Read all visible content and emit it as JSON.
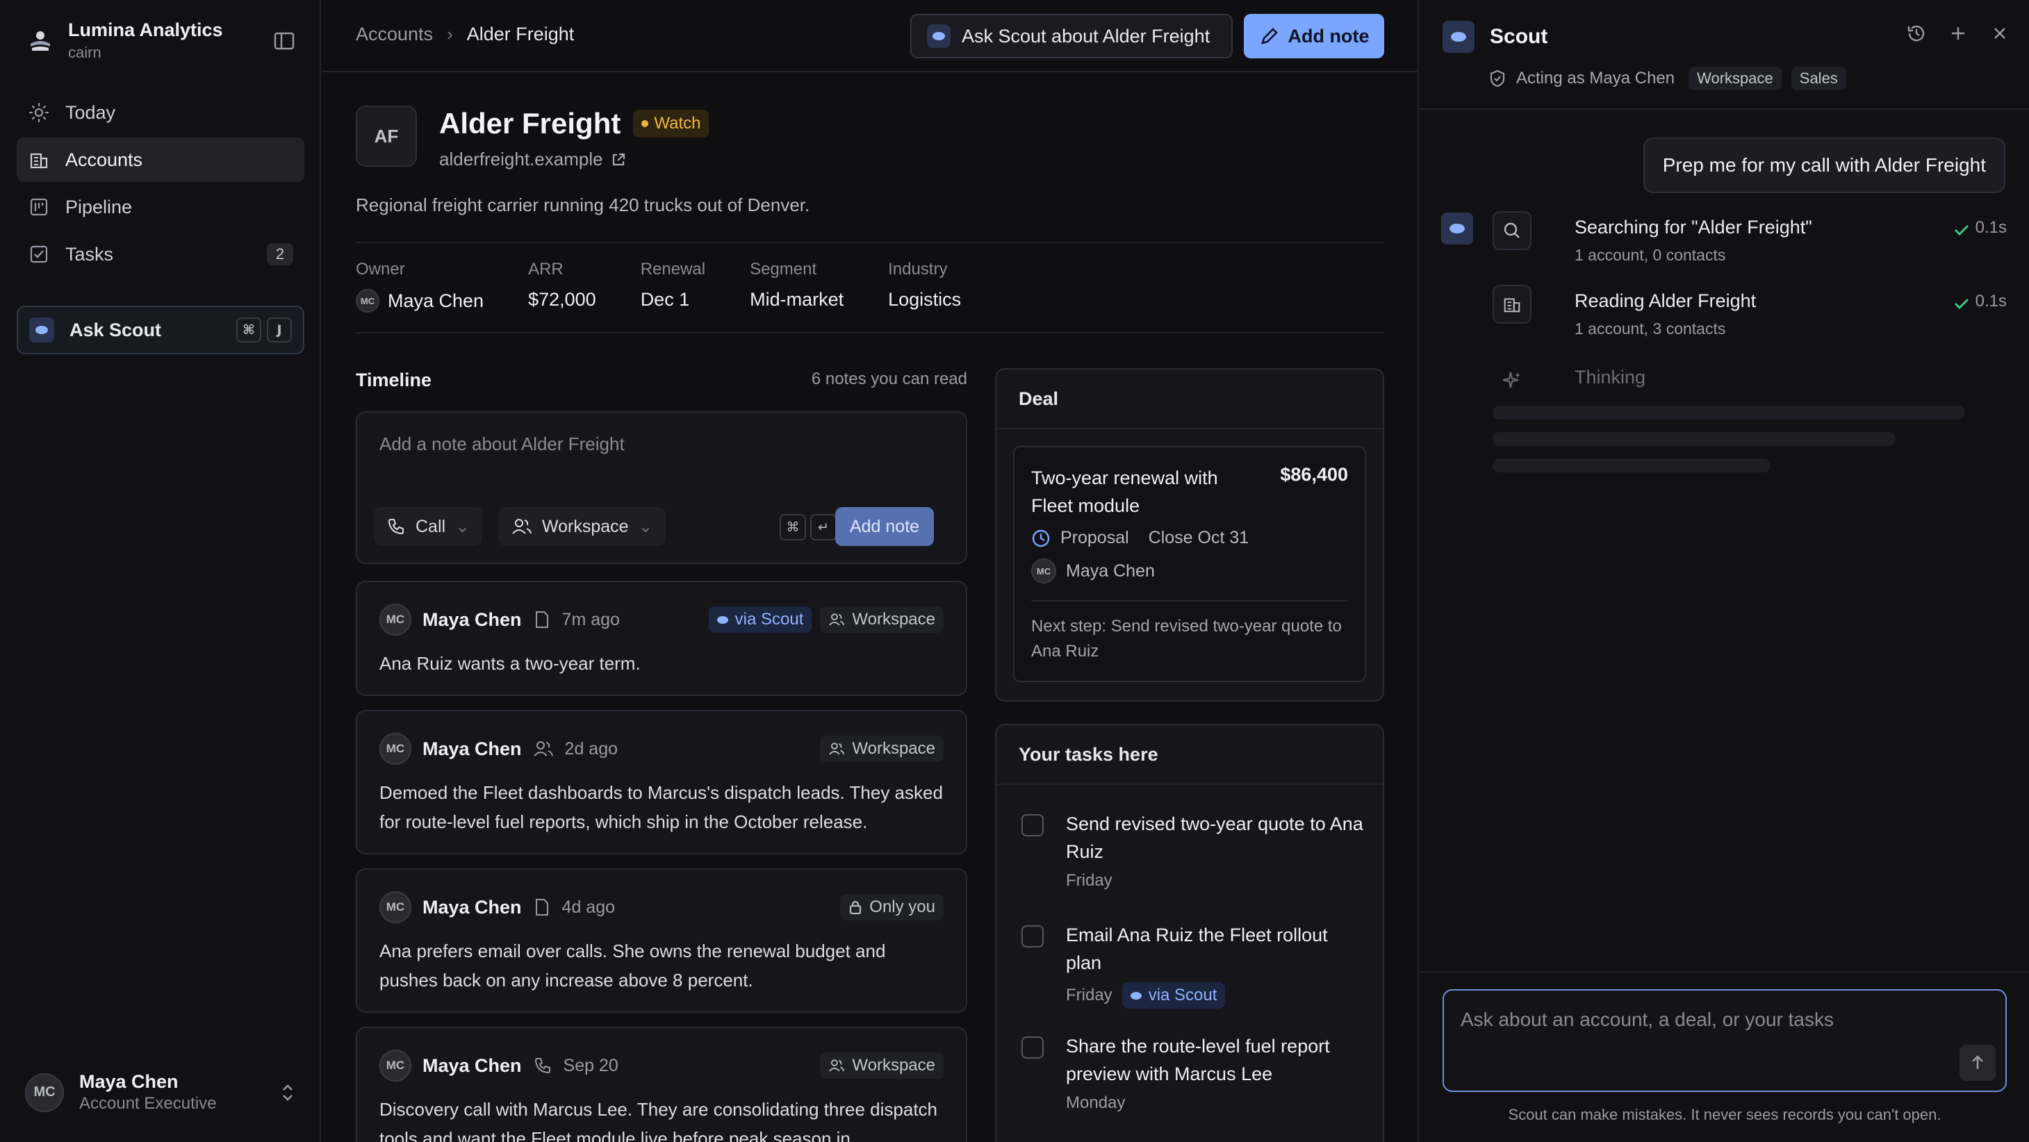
{
  "brand": {
    "name": "Lumina Analytics",
    "workspace": "cairn"
  },
  "sidebar": {
    "items": [
      {
        "label": "Today",
        "icon": "sun-icon"
      },
      {
        "label": "Accounts",
        "icon": "building-icon",
        "active": true
      },
      {
        "label": "Pipeline",
        "icon": "pipeline-icon"
      },
      {
        "label": "Tasks",
        "icon": "checkbox-icon",
        "badge": "2"
      }
    ],
    "ask_scout": {
      "label": "Ask Scout",
      "keys": [
        "⌘",
        "J"
      ]
    },
    "user": {
      "initials": "MC",
      "name": "Maya Chen",
      "role": "Account Executive"
    }
  },
  "header": {
    "breadcrumb": [
      "Accounts",
      "Alder Freight"
    ],
    "ask_button": "Ask Scout about Alder Freight",
    "add_note_button": "Add note"
  },
  "account": {
    "initials": "AF",
    "name": "Alder Freight",
    "status": "Watch",
    "domain": "alderfreight.example",
    "description": "Regional freight carrier running 420 trucks out of Denver.",
    "meta": [
      {
        "label": "Owner",
        "value": "Maya Chen",
        "avatar": "MC"
      },
      {
        "label": "ARR",
        "value": "$72,000"
      },
      {
        "label": "Renewal",
        "value": "Dec 1"
      },
      {
        "label": "Segment",
        "value": "Mid-market"
      },
      {
        "label": "Industry",
        "value": "Logistics"
      }
    ]
  },
  "timeline": {
    "title": "Timeline",
    "count_label": "6 notes you can read",
    "composer": {
      "placeholder": "Add a note about Alder Freight",
      "type": "Call",
      "visibility": "Workspace",
      "keys": [
        "⌘",
        "↵"
      ],
      "submit": "Add note"
    },
    "notes": [
      {
        "initials": "MC",
        "author": "Maya Chen",
        "kind": "note-icon",
        "time": "7m ago",
        "via": "via Scout",
        "visibility": "Workspace",
        "body": "Ana Ruiz wants a two-year term."
      },
      {
        "initials": "MC",
        "author": "Maya Chen",
        "kind": "people-icon",
        "time": "2d ago",
        "visibility": "Workspace",
        "body": "Demoed the Fleet dashboards to Marcus's dispatch leads. They asked for route-level fuel reports, which ship in the October release."
      },
      {
        "initials": "MC",
        "author": "Maya Chen",
        "kind": "note-icon",
        "time": "4d ago",
        "visibility": "Only you",
        "body": "Ana prefers email over calls. She owns the renewal budget and pushes back on any increase above 8 percent."
      },
      {
        "initials": "MC",
        "author": "Maya Chen",
        "kind": "phone-icon",
        "time": "Sep 20",
        "visibility": "Workspace",
        "body": "Discovery call with Marcus Lee. They are consolidating three dispatch tools and want the Fleet module live before peak season in"
      }
    ]
  },
  "deal": {
    "title": "Deal",
    "name": "Two-year renewal with Fleet module",
    "amount": "$86,400",
    "stage": "Proposal",
    "close": "Close Oct 31",
    "owner_initials": "MC",
    "owner": "Maya Chen",
    "next_step": "Next step: Send revised two-year quote to Ana Ruiz"
  },
  "tasks": {
    "title": "Your tasks here",
    "items": [
      {
        "title": "Send revised two-year quote to Ana Ruiz",
        "due": "Friday"
      },
      {
        "title": "Email Ana Ruiz the Fleet rollout plan",
        "due": "Friday",
        "via": "via Scout"
      },
      {
        "title": "Share the route-level fuel report preview with Marcus Lee",
        "due": "Monday"
      }
    ]
  },
  "scout": {
    "title": "Scout",
    "acting_as": "Acting as Maya Chen",
    "scopes": [
      "Workspace",
      "Sales"
    ],
    "user_message": "Prep me for my call with Alder Freight",
    "steps": [
      {
        "title": "Searching for \"Alder Freight\"",
        "sub": "1 account, 0 contacts",
        "time": "0.1s",
        "icon": "search-icon"
      },
      {
        "title": "Reading Alder Freight",
        "sub": "1 account, 3 contacts",
        "time": "0.1s",
        "icon": "building-icon"
      },
      {
        "title": "Thinking",
        "icon": "sparkle-icon"
      }
    ],
    "input_placeholder": "Ask about an account, a deal, or your tasks",
    "disclaimer": "Scout can make mistakes. It never sees records you can't open."
  },
  "colors": {
    "accent": "#7aa6ff",
    "watch": "#f2b640",
    "success": "#3fcf8e"
  }
}
